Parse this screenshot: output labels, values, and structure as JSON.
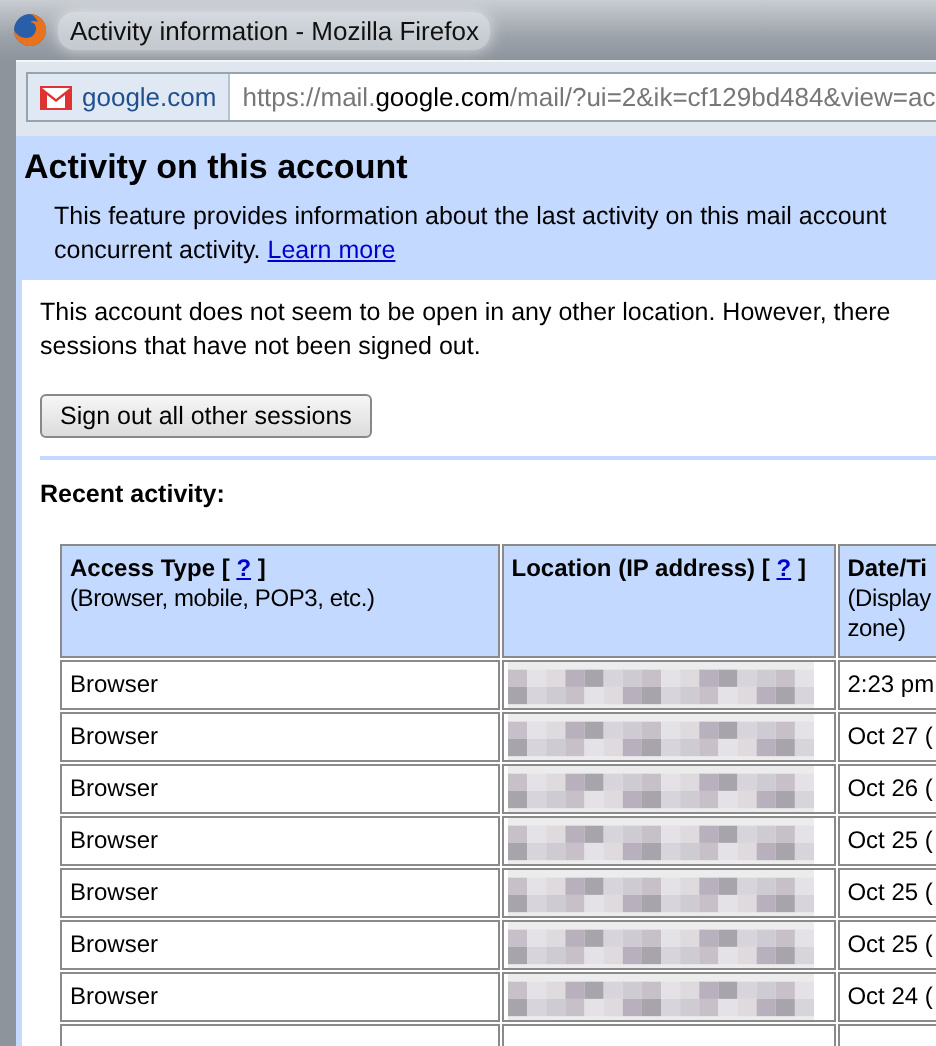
{
  "window": {
    "title": "Activity information - Mozilla Firefox"
  },
  "address_bar": {
    "site": "google.com",
    "url_prefix": "https://mail.",
    "url_domain": "google.com",
    "url_path": "/mail/?ui=2&ik=cf129bd484&view=ac"
  },
  "header": {
    "title": "Activity on this account",
    "description": "This feature provides information about the last activity on this mail account\nconcurrent activity.",
    "link": "Learn more"
  },
  "notice": "This account does not seem to be open in any other location. However, there\nsessions that have not been signed out.",
  "sign_out_button": "Sign out all other sessions",
  "recent_label": "Recent activity:",
  "table": {
    "columns": [
      {
        "title": "Access Type",
        "bracket_open": "[",
        "help": "?",
        "bracket_close": "]",
        "subtitle": "(Browser, mobile, POP3, etc.)"
      },
      {
        "title": "Location (IP address)",
        "bracket_open": "[",
        "help": "?",
        "bracket_close": "]"
      },
      {
        "title": "Date/Ti",
        "subtitle": "(Display\nzone)"
      }
    ],
    "rows": [
      {
        "access_type": "Browser",
        "location_redacted": true,
        "date": "2:23 pm"
      },
      {
        "access_type": "Browser",
        "location_redacted": true,
        "date": "Oct 27 ("
      },
      {
        "access_type": "Browser",
        "location_redacted": true,
        "date": "Oct 26 ("
      },
      {
        "access_type": "Browser",
        "location_redacted": true,
        "date": "Oct 25 ("
      },
      {
        "access_type": "Browser",
        "location_redacted": true,
        "date": "Oct 25 ("
      },
      {
        "access_type": "Browser",
        "location_redacted": true,
        "date": "Oct 25 ("
      },
      {
        "access_type": "Browser",
        "location_redacted": true,
        "date": "Oct 24 ("
      }
    ]
  }
}
